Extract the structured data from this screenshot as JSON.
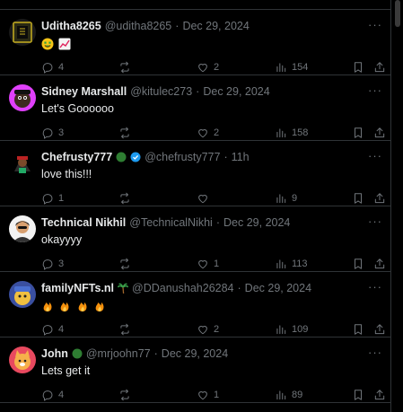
{
  "posts": [
    {
      "name": "Uditha8265",
      "handle": "@uditha8265",
      "sep": "·",
      "time": "Dec 29, 2024",
      "text": "",
      "emojis": [
        "grinning-money-face",
        "chart-increasing"
      ],
      "replies": "4",
      "reposts": "",
      "likes": "2",
      "views": "154"
    },
    {
      "name": "Sidney Marshall",
      "handle": "@kitulec273",
      "sep": "·",
      "time": "Dec 29, 2024",
      "text": "Let's Goooooo",
      "replies": "3",
      "reposts": "",
      "likes": "2",
      "views": "158"
    },
    {
      "name": "Chefrusty777",
      "handle": "@chefrusty777",
      "sep": "·",
      "time": "11h",
      "text": "love this!!!",
      "badges": [
        "green-circle",
        "verified-blue"
      ],
      "replies": "1",
      "reposts": "",
      "likes": "",
      "views": "9"
    },
    {
      "name": "Technical Nikhil",
      "handle": "@TechnicalNikhi",
      "sep": "·",
      "time": "Dec 29, 2024",
      "text": "okayyyy",
      "replies": "3",
      "reposts": "",
      "likes": "1",
      "views": "113"
    },
    {
      "name": "familyNFTs.nl",
      "handle": "@DDanushah26284",
      "sep": "·",
      "time": "Dec 29, 2024",
      "text": "",
      "badges": [
        "palm-tree"
      ],
      "emojis": [
        "fire",
        "fire",
        "fire",
        "fire"
      ],
      "replies": "4",
      "reposts": "",
      "likes": "2",
      "views": "109"
    },
    {
      "name": "John",
      "handle": "@mrjoohn77",
      "sep": "·",
      "time": "Dec 29, 2024",
      "text": "Lets get it",
      "badges": [
        "green-circle"
      ],
      "replies": "4",
      "reposts": "",
      "likes": "1",
      "views": "89"
    }
  ],
  "more_label": "···",
  "colors": {
    "background": "#000000",
    "text": "#e7e9ea",
    "muted": "#71767b",
    "divider": "#2f3336",
    "verified": "#1d9bf0",
    "green_badge": "#2e7d32"
  }
}
